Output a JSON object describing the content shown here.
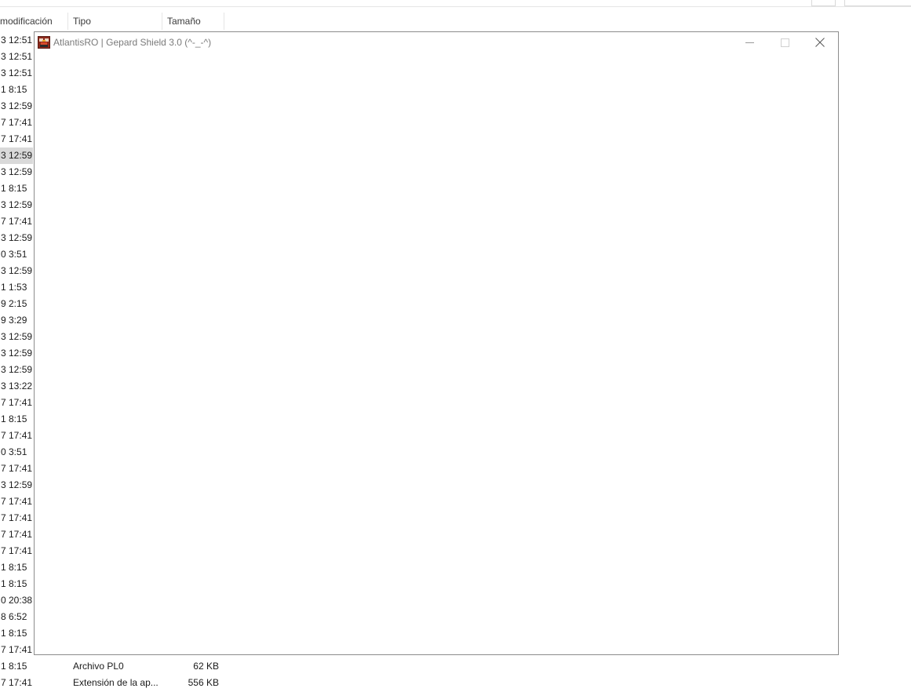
{
  "explorer": {
    "columns": [
      {
        "key": "date",
        "label": "modificación"
      },
      {
        "key": "type",
        "label": "Tipo"
      },
      {
        "key": "size",
        "label": "Tamaño"
      }
    ],
    "rows": [
      {
        "date": "3 12:51",
        "type": "",
        "size": ""
      },
      {
        "date": "3 12:51",
        "type": "",
        "size": ""
      },
      {
        "date": "3 12:51",
        "type": "",
        "size": ""
      },
      {
        "date": "1 8:15",
        "type": "",
        "size": ""
      },
      {
        "date": "3 12:59",
        "type": "",
        "size": ""
      },
      {
        "date": "7 17:41",
        "type": "",
        "size": ""
      },
      {
        "date": "7 17:41",
        "type": "",
        "size": ""
      },
      {
        "date": "3 12:59",
        "type": "",
        "size": "",
        "selected": true
      },
      {
        "date": "3 12:59",
        "type": "",
        "size": ""
      },
      {
        "date": "1 8:15",
        "type": "",
        "size": ""
      },
      {
        "date": "3 12:59",
        "type": "",
        "size": ""
      },
      {
        "date": "7 17:41",
        "type": "",
        "size": ""
      },
      {
        "date": "3 12:59",
        "type": "",
        "size": ""
      },
      {
        "date": "0 3:51",
        "type": "",
        "size": ""
      },
      {
        "date": "3 12:59",
        "type": "",
        "size": ""
      },
      {
        "date": "1 1:53",
        "type": "",
        "size": ""
      },
      {
        "date": "9 2:15",
        "type": "",
        "size": ""
      },
      {
        "date": "9 3:29",
        "type": "",
        "size": ""
      },
      {
        "date": "3 12:59",
        "type": "",
        "size": ""
      },
      {
        "date": "3 12:59",
        "type": "",
        "size": ""
      },
      {
        "date": "3 12:59",
        "type": "",
        "size": ""
      },
      {
        "date": "3 13:22",
        "type": "",
        "size": ""
      },
      {
        "date": "7 17:41",
        "type": "",
        "size": ""
      },
      {
        "date": "1 8:15",
        "type": "",
        "size": ""
      },
      {
        "date": "7 17:41",
        "type": "",
        "size": ""
      },
      {
        "date": "0 3:51",
        "type": "",
        "size": ""
      },
      {
        "date": "7 17:41",
        "type": "",
        "size": ""
      },
      {
        "date": "3 12:59",
        "type": "",
        "size": ""
      },
      {
        "date": "7 17:41",
        "type": "",
        "size": ""
      },
      {
        "date": "7 17:41",
        "type": "",
        "size": ""
      },
      {
        "date": "7 17:41",
        "type": "",
        "size": ""
      },
      {
        "date": "7 17:41",
        "type": "",
        "size": ""
      },
      {
        "date": "1 8:15",
        "type": "",
        "size": ""
      },
      {
        "date": "1 8:15",
        "type": "",
        "size": ""
      },
      {
        "date": "0 20:38",
        "type": "",
        "size": ""
      },
      {
        "date": "8 6:52",
        "type": "",
        "size": ""
      },
      {
        "date": "1 8:15",
        "type": "",
        "size": ""
      },
      {
        "date": "7 17:41",
        "type": "",
        "size": ""
      },
      {
        "date": "1 8:15",
        "type": "Archivo PL0",
        "size": "62 KB"
      },
      {
        "date": "7 17:41",
        "type": "Extensión de la ap...",
        "size": "556 KB"
      }
    ]
  },
  "window": {
    "title": "AtlantisRO | Gepard Shield 3.0 (^-_-^)",
    "icon": "atlantisro-app-icon",
    "controls": {
      "minimize": "minimize-icon",
      "maximize": "maximize-icon",
      "close": "close-icon"
    }
  },
  "colors": {
    "title_text": "#7a7a7a",
    "window_border": "#8c8c8c",
    "selected_row": "#d9d9d9"
  }
}
